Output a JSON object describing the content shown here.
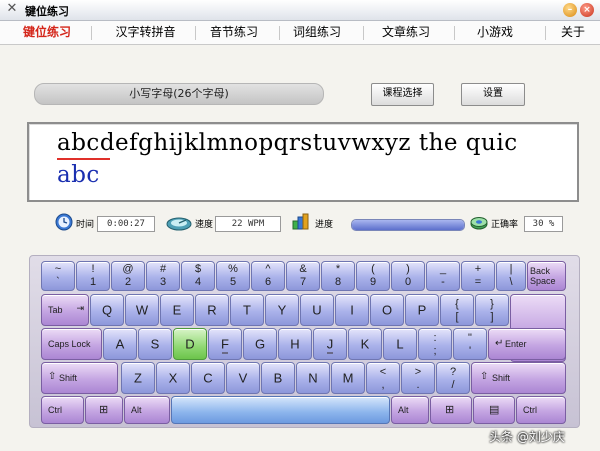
{
  "window": {
    "title": "键位练习",
    "app_icon": "x-logo-icon",
    "minimize_icon": "minimize-icon",
    "close_icon": "close-icon"
  },
  "menu": {
    "tabs": [
      {
        "label": "键位练习",
        "active": true
      },
      {
        "label": "汉字转拼音"
      },
      {
        "label": "音节练习"
      },
      {
        "label": "词组练习"
      },
      {
        "label": "文章练习"
      },
      {
        "label": "小游戏"
      },
      {
        "label": "关于"
      }
    ]
  },
  "lesson": {
    "title": "小写字母(26个字母)",
    "select_button": "课程选择",
    "settings_button": "设置"
  },
  "practice": {
    "target_text": "abcdefghijklmnopqrstuvwxyz the quic",
    "typed_text": "abc"
  },
  "stats": {
    "time_label": "时间",
    "time_value": "0:00:27",
    "speed_label": "速度",
    "speed_value": "22 WPM",
    "progress_label": "进度",
    "progress_fraction": 1.0,
    "accuracy_label": "正确率",
    "accuracy_value": "30 %",
    "icons": {
      "time": "clock-icon",
      "speed": "speedometer-icon",
      "progress": "progress-blocks-icon",
      "accuracy": "target-disk-icon"
    }
  },
  "keyboard": {
    "highlight_key": "D",
    "rows": {
      "number": [
        {
          "top": "~",
          "bot": "`"
        },
        {
          "top": "!",
          "bot": "1"
        },
        {
          "top": "@",
          "bot": "2"
        },
        {
          "top": "#",
          "bot": "3"
        },
        {
          "top": "$",
          "bot": "4"
        },
        {
          "top": "%",
          "bot": "5"
        },
        {
          "top": "^",
          "bot": "6"
        },
        {
          "top": "&",
          "bot": "7"
        },
        {
          "top": "*",
          "bot": "8"
        },
        {
          "top": "(",
          "bot": "9"
        },
        {
          "top": ")",
          "bot": "0"
        },
        {
          "top": "_",
          "bot": "-"
        },
        {
          "top": "+",
          "bot": "="
        },
        {
          "top": "|",
          "bot": "\\"
        }
      ],
      "backspace": "Back Space",
      "tab": "Tab",
      "top_letters": [
        "Q",
        "W",
        "E",
        "R",
        "T",
        "Y",
        "U",
        "I",
        "O",
        "P"
      ],
      "top_symbols": [
        {
          "top": "{",
          "bot": "["
        },
        {
          "top": "}",
          "bot": "]"
        }
      ],
      "capslock": "Caps Lock",
      "home_letters": [
        "A",
        "S",
        "D",
        "F",
        "G",
        "H",
        "J",
        "K",
        "L"
      ],
      "home_symbols": [
        {
          "top": ":",
          "bot": ";"
        },
        {
          "top": "\"",
          "bot": "'"
        }
      ],
      "enter": "Enter",
      "shift_left": "Shift",
      "bottom_letters": [
        "Z",
        "X",
        "C",
        "V",
        "B",
        "N",
        "M"
      ],
      "bottom_symbols": [
        {
          "top": "<",
          "bot": ","
        },
        {
          "top": ">",
          "bot": "."
        },
        {
          "top": "?",
          "bot": "/"
        }
      ],
      "shift_right": "Shift",
      "ctrl_left": "Ctrl",
      "alt_left": "Alt",
      "alt_right": "Alt",
      "ctrl_right": "Ctrl"
    }
  },
  "watermark": "头条 @刘少庆"
}
